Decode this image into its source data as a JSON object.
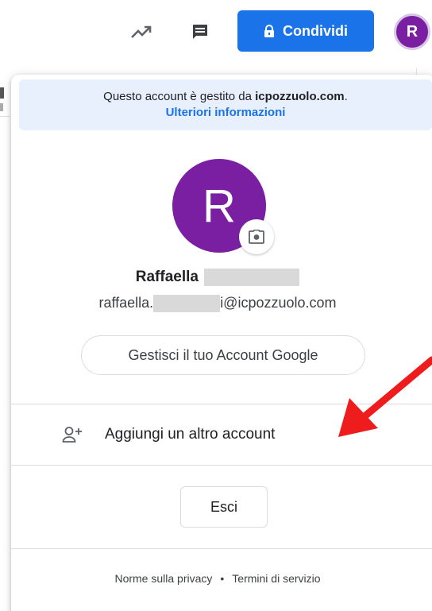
{
  "toolbar": {
    "trend_icon": "trending-up-icon",
    "comment_icon": "comment-icon",
    "share_label": "Condividi",
    "avatar_letter": "R",
    "accent_color": "#1a73e8",
    "avatar_color": "#7b1fa2"
  },
  "panel": {
    "managed_prefix": "Questo account è gestito da ",
    "managed_domain": "icpozzuolo.com",
    "managed_suffix": ".",
    "more_info_link": "Ulteriori informazioni",
    "avatar_letter": "R",
    "user_first_name": "Raffaella",
    "email_prefix": "raffaella.",
    "email_suffix": "i@icpozzuolo.com",
    "manage_account_label": "Gestisci il tuo Account Google",
    "add_account_label": "Aggiungi un altro account",
    "sign_out_label": "Esci",
    "privacy_link": "Norme sulla privacy",
    "separator": "•",
    "terms_link": "Termini di servizio"
  },
  "annotation": {
    "arrow_color": "#ee1c1c"
  }
}
